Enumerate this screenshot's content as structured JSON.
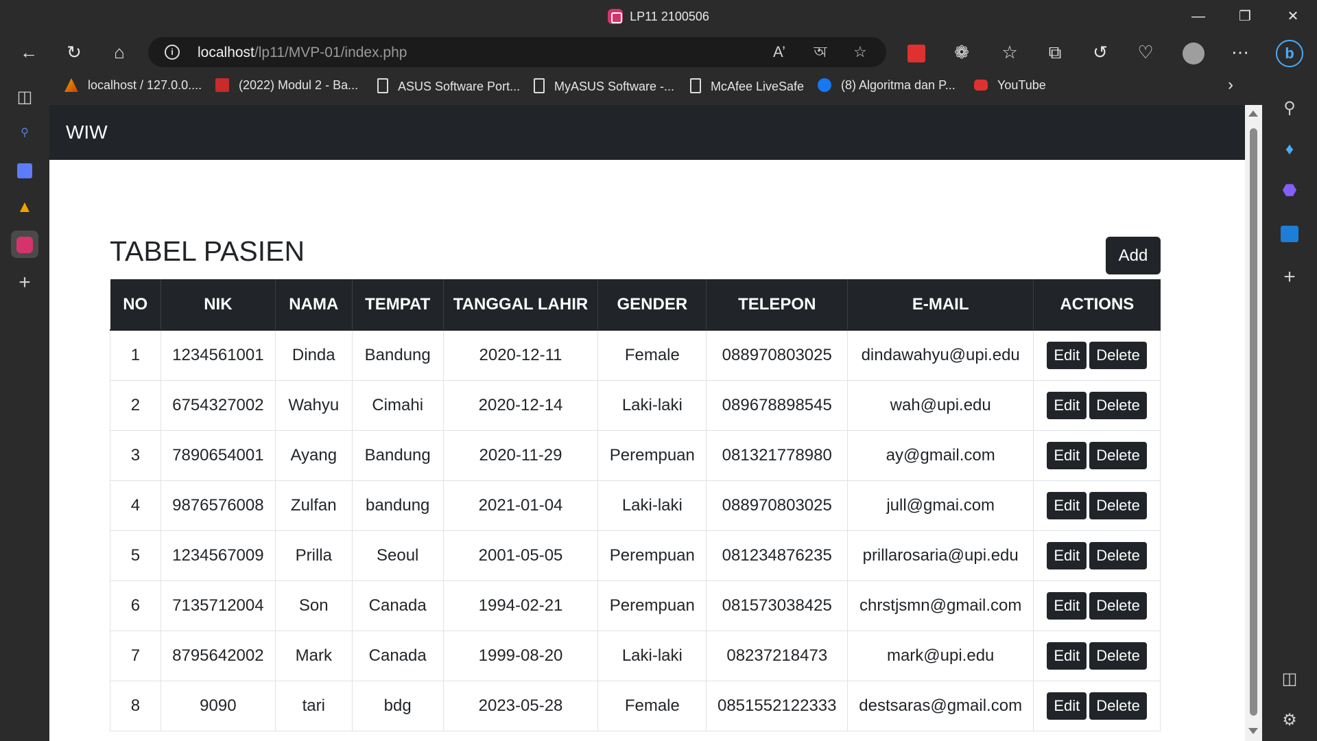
{
  "window": {
    "title": "LP11 2100506"
  },
  "toolbar": {
    "url_host": "localhost",
    "url_path": "/lp11/MVP-01/index.php"
  },
  "bookmarks": [
    {
      "label": "localhost / 127.0.0....",
      "icon": "phpmyadmin-icon"
    },
    {
      "label": "(2022) Modul 2 - Ba...",
      "icon": "pdf-icon"
    },
    {
      "label": "ASUS Software Port...",
      "icon": "document-icon"
    },
    {
      "label": "MyASUS Software -...",
      "icon": "document-icon"
    },
    {
      "label": "McAfee LiveSafe",
      "icon": "document-icon"
    },
    {
      "label": "(8) Algoritma dan P...",
      "icon": "facebook-icon"
    },
    {
      "label": "YouTube",
      "icon": "youtube-icon"
    }
  ],
  "page": {
    "brand": "WIW",
    "title": "TABEL PASIEN",
    "add_label": "Add",
    "columns": [
      "NO",
      "NIK",
      "NAMA",
      "TEMPAT",
      "TANGGAL LAHIR",
      "GENDER",
      "TELEPON",
      "E-MAIL",
      "ACTIONS"
    ],
    "edit_label": "Edit",
    "delete_label": "Delete",
    "rows": [
      [
        "1",
        "1234561001",
        "Dinda",
        "Bandung",
        "2020-12-11",
        "Female",
        "088970803025",
        "dindawahyu@upi.edu"
      ],
      [
        "2",
        "6754327002",
        "Wahyu",
        "Cimahi",
        "2020-12-14",
        "Laki-laki",
        "089678898545",
        "wah@upi.edu"
      ],
      [
        "3",
        "7890654001",
        "Ayang",
        "Bandung",
        "2020-11-29",
        "Perempuan",
        "081321778980",
        "ay@gmail.com"
      ],
      [
        "4",
        "9876576008",
        "Zulfan",
        "bandung",
        "2021-01-04",
        "Laki-laki",
        "088970803025",
        "jull@gmai.com"
      ],
      [
        "5",
        "1234567009",
        "Prilla",
        "Seoul",
        "2001-05-05",
        "Perempuan",
        "081234876235",
        "prillarosaria@upi.edu"
      ],
      [
        "6",
        "7135712004",
        "Son",
        "Canada",
        "1994-02-21",
        "Perempuan",
        "081573038425",
        "chrstjsmn@gmail.com"
      ],
      [
        "7",
        "8795642002",
        "Mark",
        "Canada",
        "1999-08-20",
        "Laki-laki",
        "08237218473",
        "mark@upi.edu"
      ],
      [
        "8",
        "9090",
        "tari",
        "bdg",
        "2023-05-28",
        "Female",
        "0851552122333",
        "destsaras@gmail.com"
      ]
    ]
  },
  "colors": {
    "navbar": "#212529",
    "browser_chrome": "#2b2b2b",
    "favicon": "#d6336c"
  }
}
